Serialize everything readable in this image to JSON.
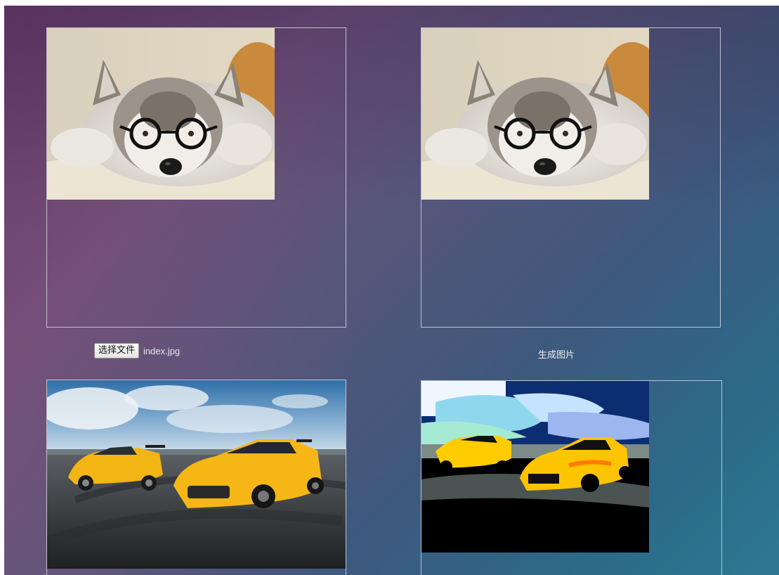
{
  "upload": {
    "choose_file_label": "选择文件",
    "file_name": "index.jpg"
  },
  "actions": {
    "generate_label": "生成图片"
  },
  "images": {
    "top_left": "husky-with-glasses-photo",
    "top_right": "husky-with-glasses-photo",
    "bottom_left": "yellow-sports-cars-photo",
    "bottom_right": "yellow-sports-cars-posterized-photo"
  },
  "colors": {
    "frame_border": "#e6e6f0",
    "background_start": "#4e2f5f",
    "background_end": "#2e7893"
  }
}
